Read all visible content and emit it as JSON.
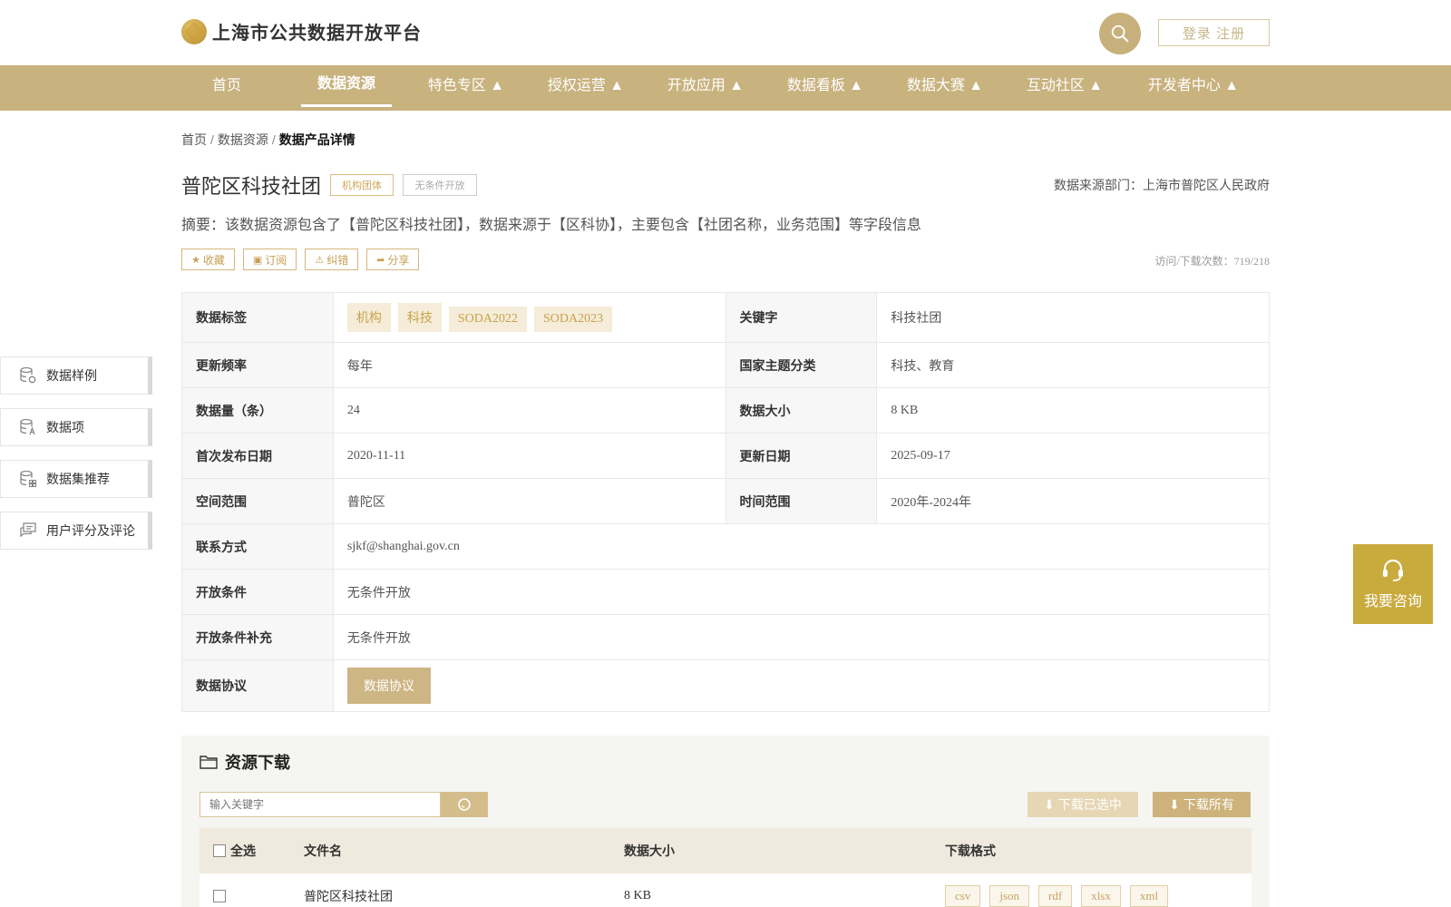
{
  "header": {
    "site_title": "上海市公共数据开放平台",
    "login_label": "登录 注册"
  },
  "nav": {
    "items": [
      {
        "label": "首页"
      },
      {
        "label": "数据资源"
      },
      {
        "label": "特色专区 ▲"
      },
      {
        "label": "授权运营 ▲"
      },
      {
        "label": "开放应用 ▲"
      },
      {
        "label": "数据看板 ▲"
      },
      {
        "label": "数据大赛 ▲"
      },
      {
        "label": "互动社区 ▲"
      },
      {
        "label": "开发者中心 ▲"
      }
    ]
  },
  "breadcrumb": {
    "home": "首页",
    "resources": "数据资源",
    "sep": "/",
    "current": "数据产品详情"
  },
  "dataset": {
    "title": "普陀区科技社团",
    "tag_org": "机构团体",
    "tag_open": "无条件开放",
    "source_dept": "数据来源部门：上海市普陀区人民政府",
    "summary": "摘要：该数据资源包含了【普陀区科技社团】，数据来源于【区科协】，主要包含【社团名称，业务范围】等字段信息",
    "visits": "访问/下载次数：719/218"
  },
  "actions": {
    "favorite": "收藏",
    "subscribe": "订阅",
    "report": "纠错",
    "share": "分享"
  },
  "info": {
    "tags_label": "数据标签",
    "tags": [
      "机构",
      "科技",
      "SODA2022",
      "SODA2023"
    ],
    "keyword_label": "关键字",
    "keyword": "科技社团",
    "freq_label": "更新频率",
    "freq": "每年",
    "theme_label": "国家主题分类",
    "theme": "科技、教育",
    "count_label": "数据量（条）",
    "count": "24",
    "size_label": "数据大小",
    "size": "8 KB",
    "first_pub_label": "首次发布日期",
    "first_pub": "2020-11-11",
    "updated_label": "更新日期",
    "updated": "2025-09-17",
    "space_label": "空间范围",
    "space": "普陀区",
    "time_label": "时间范围",
    "time": "2020年-2024年",
    "contact_label": "联系方式",
    "contact": "sjkf@shanghai.gov.cn",
    "cond_label": "开放条件",
    "cond": "无条件开放",
    "cond_extra_label": "开放条件补充",
    "cond_extra": "无条件开放",
    "protocol_label": "数据协议",
    "protocol_btn": "数据协议"
  },
  "side": {
    "items": [
      {
        "label": "数据样例",
        "icon": "database-sample-icon"
      },
      {
        "label": "数据项",
        "icon": "database-item-icon"
      },
      {
        "label": "数据集推荐",
        "icon": "database-recommend-icon"
      },
      {
        "label": "用户评分及评论",
        "icon": "comment-icon"
      }
    ]
  },
  "consult": {
    "label": "我要咨询"
  },
  "download": {
    "title": "资源下载",
    "search_placeholder": "输入关键字",
    "btn_selected": "下载已选中",
    "btn_all": "下载所有",
    "col_select_all": "全选",
    "col_filename": "文件名",
    "col_size": "数据大小",
    "col_format": "下载格式",
    "rows": [
      {
        "filename": "普陀区科技社团",
        "size": "8 KB",
        "formats": [
          "csv",
          "json",
          "rdf",
          "xlsx",
          "xml"
        ]
      }
    ]
  },
  "colors": {
    "brand": "#c8b27e",
    "accent": "#c9aa3c"
  }
}
